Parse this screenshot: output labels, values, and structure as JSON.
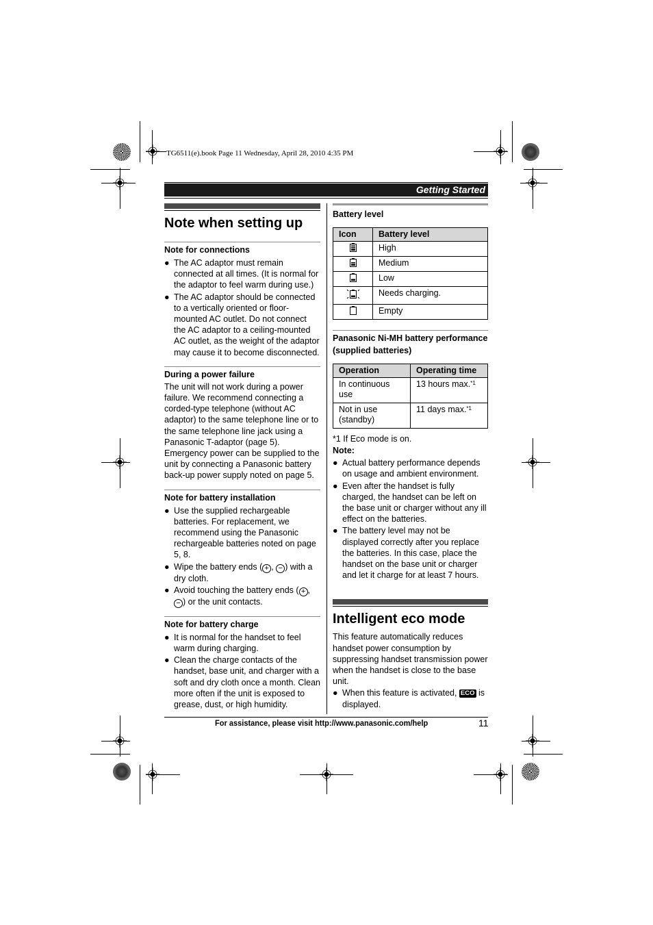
{
  "print_info": "TG6511(e).book  Page 11  Wednesday, April 28, 2010  4:35 PM",
  "header": {
    "section": "Getting Started"
  },
  "left": {
    "title": "Note when setting up",
    "connections": {
      "heading": "Note for connections",
      "bullets": [
        "The AC adaptor must remain connected at all times. (It is normal for the adaptor to feel warm during use.)",
        "The AC adaptor should be connected to a vertically oriented or floor-mounted AC outlet. Do not connect the AC adaptor to a ceiling-mounted AC outlet, as the weight of the adaptor may cause it to become disconnected."
      ]
    },
    "power_failure": {
      "heading": "During a power failure",
      "text": "The unit will not work during a power failure. We recommend connecting a corded-type telephone (without AC adaptor) to the same telephone line or to the same telephone line jack using a Panasonic T-adaptor (page 5). Emergency power can be supplied to the unit by connecting a Panasonic battery back-up power supply noted on page 5."
    },
    "battery_installation": {
      "heading": "Note for battery installation",
      "bullet1": "Use the supplied rechargeable batteries. For replacement, we recommend using the Panasonic rechargeable batteries noted on page 5, 8.",
      "bullet2_pre": "Wipe the battery ends (",
      "bullet2_post": ") with a dry cloth.",
      "bullet3_pre": "Avoid touching the battery ends (",
      "bullet3_post": ") or the unit contacts.",
      "plus": "+",
      "minus": "−"
    },
    "battery_charge": {
      "heading": "Note for battery charge",
      "bullets": [
        "It is normal for the handset to feel warm during charging.",
        "Clean the charge contacts of the handset, base unit, and charger with a soft and dry cloth once a month. Clean more often if the unit is exposed to grease, dust, or high humidity."
      ]
    }
  },
  "right": {
    "battery_level": {
      "heading": "Battery level",
      "columns": [
        "Icon",
        "Battery level"
      ],
      "rows": [
        {
          "icon": "battery-high-icon",
          "level": "High"
        },
        {
          "icon": "battery-medium-icon",
          "level": "Medium"
        },
        {
          "icon": "battery-low-icon",
          "level": "Low"
        },
        {
          "icon": "battery-needs-charging-icon",
          "level": "Needs charging."
        },
        {
          "icon": "battery-empty-icon",
          "level": "Empty"
        }
      ]
    },
    "performance": {
      "heading": "Panasonic Ni-MH battery performance (supplied batteries)",
      "columns": [
        "Operation",
        "Operating time"
      ],
      "rows": [
        {
          "operation": "In continuous use",
          "time": "13 hours max.",
          "note": "*1"
        },
        {
          "operation": "Not in use (standby)",
          "time": "11 days max.",
          "note": "*1"
        }
      ],
      "footnote": "*1 If Eco mode is on."
    },
    "note": {
      "label": "Note:",
      "bullets": [
        "Actual battery performance depends on usage and ambient environment.",
        "Even after the handset is fully charged, the handset can be left on the base unit or charger without any ill effect on the batteries.",
        "The battery level may not be displayed correctly after you replace the batteries. In this case, place the handset on the base unit or charger and let it charge for at least 7 hours."
      ]
    },
    "eco": {
      "title": "Intelligent eco mode",
      "text": "This feature automatically reduces handset power consumption by suppressing handset transmission power when the handset is close to the base unit.",
      "bullet_pre": "When this feature is activated, ",
      "badge": "ECO",
      "bullet_post": " is displayed."
    }
  },
  "footer": {
    "assistance": "For assistance, please visit http://www.panasonic.com/help",
    "page_number": "11"
  },
  "bullet_glyph": "●"
}
